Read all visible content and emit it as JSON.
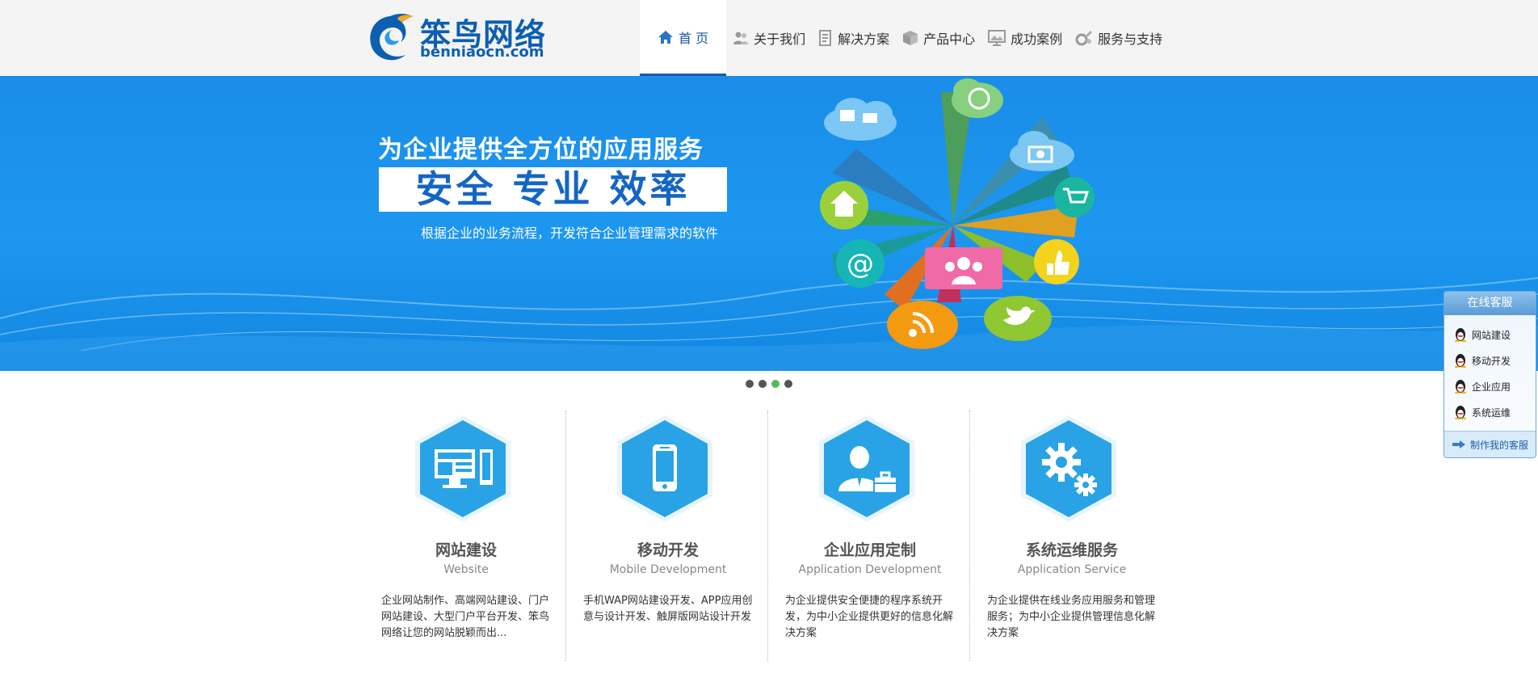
{
  "header": {
    "logo_cn": "笨鸟网络",
    "logo_en": "benniaocn.com",
    "nav": [
      {
        "label": "首 页",
        "icon": "home-icon"
      },
      {
        "label": "关于我们",
        "icon": "people-icon"
      },
      {
        "label": "解决方案",
        "icon": "document-icon"
      },
      {
        "label": "产品中心",
        "icon": "cube-icon"
      },
      {
        "label": "成功案例",
        "icon": "picture-icon"
      },
      {
        "label": "服务与支持",
        "icon": "tools-icon"
      }
    ],
    "active_nav": 0
  },
  "banner": {
    "title": "为企业提供全方位的应用服务",
    "slogan": "安全  专业  效率",
    "subtitle": "根据企业的业务流程，开发符合企业管理需求的软件"
  },
  "slider": {
    "dot_count": 4,
    "active_dot": 2
  },
  "services": [
    {
      "title": "网站建设",
      "en": "Website",
      "icon": "monitor-icon",
      "desc": "企业网站制作、高端网站建设、门户网站建设、大型门户平台开发、笨鸟网络让您的网站脱颖而出..."
    },
    {
      "title": "移动开发",
      "en": "Mobile Development",
      "icon": "phone-icon",
      "desc": "手机WAP网站建设开发、APP应用创意与设计开发、触屏版网站设计开发"
    },
    {
      "title": "企业应用定制",
      "en": "Application Development",
      "icon": "businessman-icon",
      "desc": "为企业提供安全便捷的程序系统开发，为中小企业提供更好的信息化解决方案"
    },
    {
      "title": "系统运维服务",
      "en": "Application Service",
      "icon": "gears-icon",
      "desc": "为企业提供在线业务应用服务和管理服务；为中小企业提供管理信息化解决方案"
    }
  ],
  "online_service": {
    "title": "在线客服",
    "items": [
      "网站建设",
      "移动开发",
      "企业应用",
      "系统运维"
    ],
    "footer": "制作我的客服"
  },
  "colors": {
    "brand_blue": "#0c5fb1",
    "banner_blue": "#1d97f0",
    "hex_blue": "#29a3e6",
    "dot_active": "#5cb85c"
  }
}
